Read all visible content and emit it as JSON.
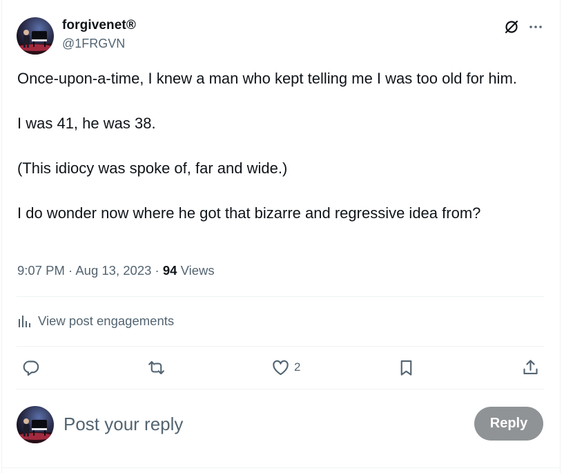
{
  "author": {
    "display_name": "forgivenet®",
    "handle": "@1FRGVN"
  },
  "post": {
    "paragraphs": [
      "Once-upon-a-time, I knew a man who kept telling me I was too old for him.",
      "I was 41, he was 38.",
      "(This idiocy was spoke of, far and wide.)",
      "I do wonder now where he got that bizarre and regressive idea from?"
    ],
    "time": "9:07 PM",
    "separator": " · ",
    "date": "Aug 13, 2023",
    "views_count": "94",
    "views_label": "Views"
  },
  "engagements": {
    "label": "View post engagements",
    "icon": "bar-chart-icon"
  },
  "actions": {
    "reply_icon": "comment-icon",
    "repost_icon": "repost-icon",
    "like_icon": "heart-icon",
    "like_count": "2",
    "bookmark_icon": "bookmark-icon",
    "share_icon": "share-icon"
  },
  "header_icons": [
    "grok-icon",
    "more-icon"
  ],
  "composer": {
    "placeholder": "Post your reply",
    "button_label": "Reply"
  },
  "colors": {
    "text_primary": "#0f1419",
    "text_secondary": "#536471",
    "divider": "#eff3f4",
    "reply_button_disabled": "#8f9396"
  }
}
